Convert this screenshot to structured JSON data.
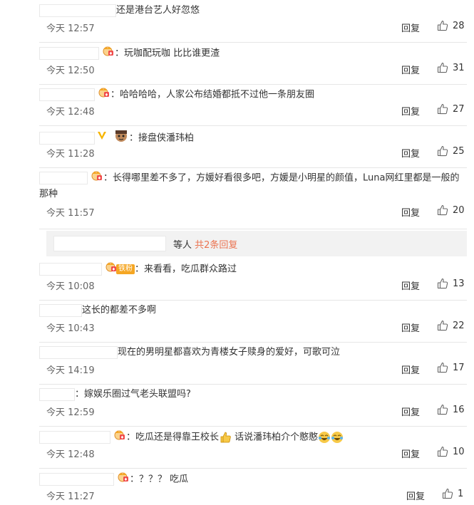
{
  "comments": [
    {
      "text": "还是港台艺人好忽悠",
      "time": "今天 12:57",
      "reply": "回复",
      "likes": "28"
    },
    {
      "text": "玩咖配玩咖 比比谁更渣",
      "time": "今天 12:50",
      "reply": "回复",
      "likes": "31"
    },
    {
      "text": "哈哈哈哈，人家公布结婚都抵不过他一条朋友圈",
      "time": "今天 12:48",
      "reply": "回复",
      "likes": "27"
    },
    {
      "text": "接盘侠潘玮柏",
      "time": "今天 11:28",
      "reply": "回复",
      "likes": "25"
    },
    {
      "text": "长得哪里差不多了，方媛好看很多吧，方媛是小明星的颜值，Luna网红里都是一般的那种",
      "time": "今天 11:57",
      "reply": "回复",
      "likes": "20",
      "sub_reply": {
        "text": "等人",
        "link": "共2条回复"
      }
    },
    {
      "text": "来看看，吃瓜群众路过",
      "time": "今天 10:08",
      "reply": "回复",
      "likes": "13",
      "fan_badge": "铁粉"
    },
    {
      "text": "这长的都差不多啊",
      "time": "今天 10:43",
      "reply": "回复",
      "likes": "22"
    },
    {
      "text": "现在的男明星都喜欢为青楼女子赎身的爱好，可歌可泣",
      "time": "今天 14:19",
      "reply": "回复",
      "likes": "17"
    },
    {
      "text": "嫁娱乐圈过气老头联盟吗?",
      "time": "今天 12:59",
      "reply": "回复",
      "likes": "16"
    },
    {
      "text_a": "吃瓜还是得靠王校长",
      "text_b": " 话说潘玮柏介个憨憨",
      "time": "今天 12:48",
      "reply": "回复",
      "likes": "10"
    },
    {
      "text": "？？？ 吃瓜",
      "time": "今天 11:27",
      "reply": "回复",
      "likes": "1"
    }
  ],
  "colors": {
    "link": "#eb7350",
    "text": "#333333",
    "time": "#666666",
    "divider": "#e6e6e6",
    "badge_orange": "#f5a623",
    "vip_gold": "#f7b500"
  },
  "icons": {
    "like": "thumbs-up-icon",
    "member": "member-crown-icon",
    "vip": "vip-v-icon"
  }
}
